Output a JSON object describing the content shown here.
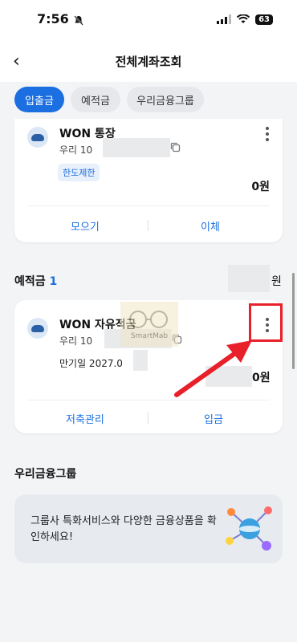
{
  "status_bar": {
    "time": "7:56",
    "battery": "63"
  },
  "header": {
    "title": "전체계좌조회"
  },
  "tabs": [
    {
      "label": "입출금",
      "active": true
    },
    {
      "label": "예적금",
      "active": false
    },
    {
      "label": "우리금융그룹",
      "active": false
    }
  ],
  "account1": {
    "name": "WON 통장",
    "number_prefix": "우리 10",
    "badge": "한도제한",
    "balance": "0원",
    "actions": [
      "모으기",
      "이체"
    ]
  },
  "savings_section": {
    "title": "예적금",
    "count": "1",
    "total_suffix": "원"
  },
  "account2": {
    "name": "WON 자유적금",
    "number_prefix": "우리 10",
    "maturity_prefix": "만기일 2027.0",
    "balance_suffix": "0원",
    "actions": [
      "저축관리",
      "입금"
    ]
  },
  "watermark": {
    "text": "SmartMab"
  },
  "group_section": {
    "title": "우리금융그룹"
  },
  "promo": {
    "text": "그룹사 특화서비스와 다양한 금융상품을 확인하세요!"
  },
  "colors": {
    "accent": "#1b6fe0",
    "annotation": "#e8202a"
  }
}
